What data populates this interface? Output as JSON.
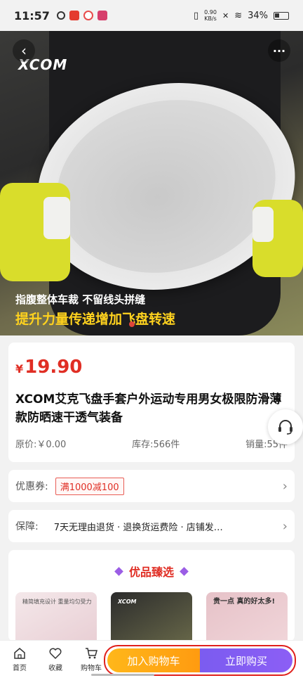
{
  "status_bar": {
    "time": "11:57",
    "net_speed_value": "0.90",
    "net_speed_unit": "KB/s",
    "battery": "34%"
  },
  "hero": {
    "logo_text": "XCOM",
    "caption_line1": "指腹整体车裁 不留线头拼缝",
    "caption_line2": "提升力量传递增加飞盘转速",
    "icons": [
      "back-icon",
      "more-icon"
    ]
  },
  "product": {
    "currency": "¥",
    "price": "19.90",
    "title": "XCOM艾克飞盘手套户外运动专用男女极限防滑薄款防晒速干透气装备",
    "original_price": "原价:￥0.00",
    "stock": "库存:566件",
    "sales": "销量:55件"
  },
  "coupon": {
    "label": "优惠券:",
    "tag": "满1000减100"
  },
  "guarantee": {
    "label": "保障:",
    "text": "7天无理由退货 · 退换货运费险 · 店铺发…"
  },
  "recommend": {
    "title": "优品臻选",
    "items": [
      {
        "text": "精简填充设计 重量均匀受力"
      },
      {
        "text": "XCOM"
      },
      {
        "text": "贵一点 真的好太多!"
      }
    ]
  },
  "bottom_bar": {
    "home": "首页",
    "favorite": "收藏",
    "cart": "购物车",
    "add_to_cart": "加入购物车",
    "buy_now": "立即购买"
  },
  "colors": {
    "price_red": "#e02e24",
    "cart_orange": "#ffa516",
    "buy_purple": "#8060f2"
  }
}
